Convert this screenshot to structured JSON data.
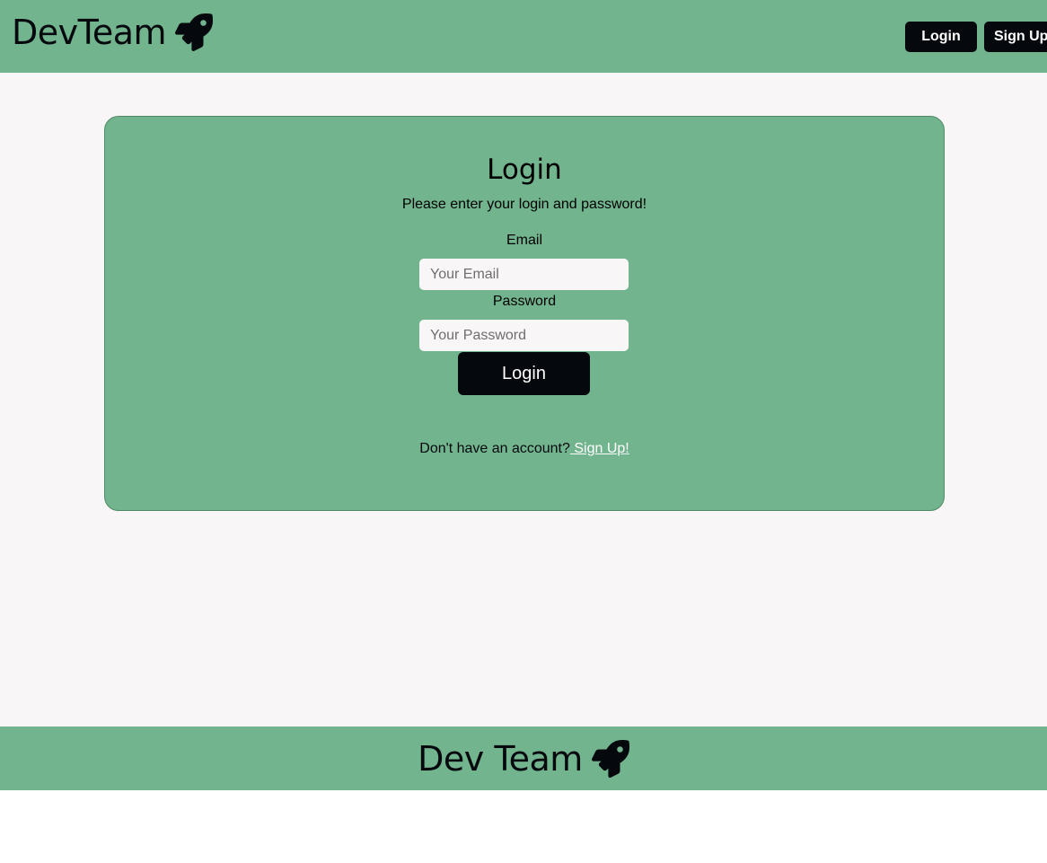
{
  "header": {
    "brand": "DevTeam",
    "brand_icon": "rocket-icon",
    "login_label": "Login",
    "signup_label": "Sign Up"
  },
  "login_card": {
    "title": "Login",
    "subtitle": "Please enter your login and password!",
    "email_label": "Email",
    "email_placeholder": "Your Email",
    "email_value": "",
    "password_label": "Password",
    "password_placeholder": "Your Password",
    "password_value": "",
    "submit_label": "Login",
    "signup_prompt": "Don't have an account?",
    "signup_link": " Sign Up!"
  },
  "footer": {
    "brand": "Dev Team",
    "brand_icon": "rocket-icon"
  },
  "colors": {
    "brand_green": "#72b48e",
    "dark": "#05080d",
    "page_bg": "#f9f6f7"
  }
}
